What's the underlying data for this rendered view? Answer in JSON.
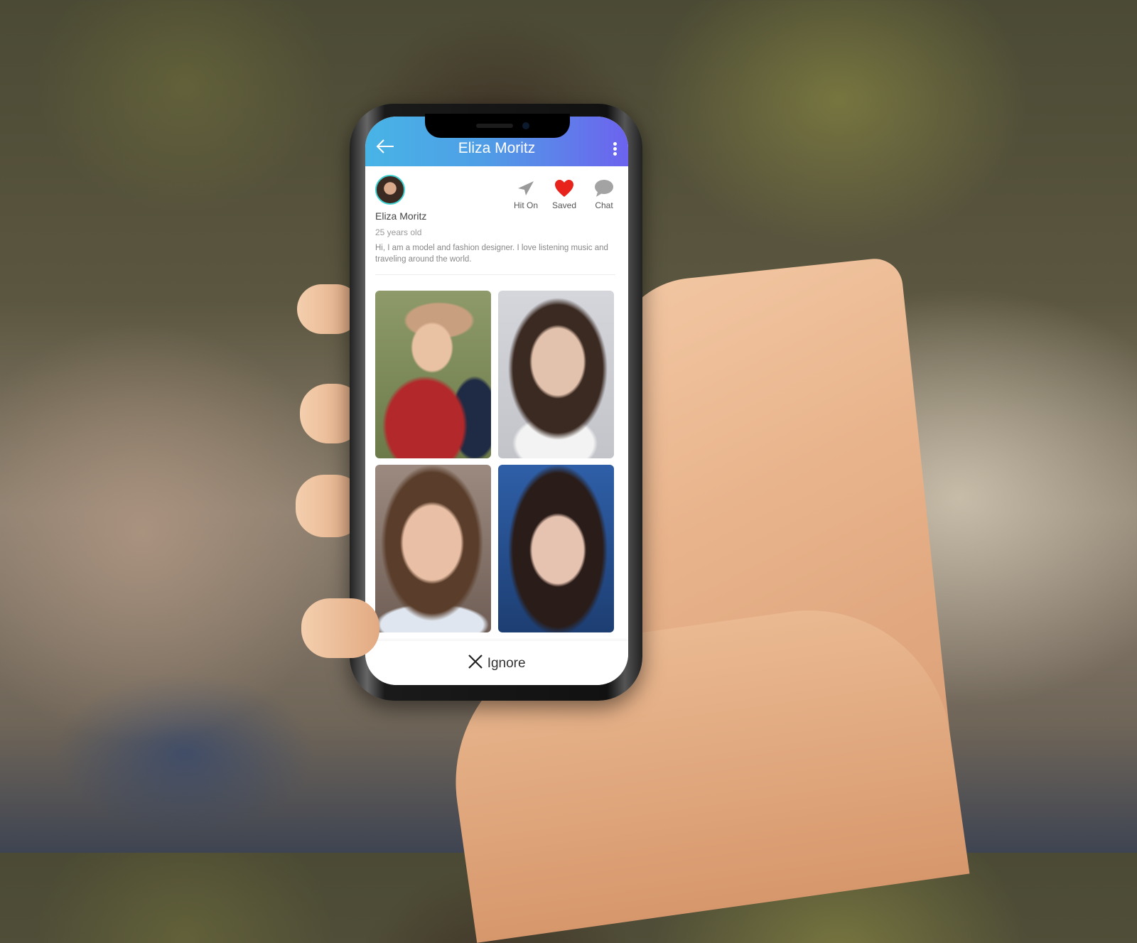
{
  "app": {
    "header": {
      "title": "Eliza Moritz",
      "back_icon": "arrow-left-icon",
      "menu_icon": "more-vertical-icon",
      "gradient_start": "#48b4e6",
      "gradient_end": "#6c63ee"
    },
    "profile": {
      "name": "Eliza Moritz",
      "age": "25 years old",
      "bio": "Hi, I am a model and fashion designer. I love listening music and traveling around the world.",
      "avatar_border_color": "#3fd0d0"
    },
    "actions": [
      {
        "label": "Hit On",
        "icon": "paper-plane-icon",
        "color": "#9a9a9a"
      },
      {
        "label": "Saved",
        "icon": "heart-icon",
        "color": "#e8231b"
      },
      {
        "label": "Chat",
        "icon": "chat-bubble-icon",
        "color": "#9a9a9a"
      }
    ],
    "photos": [
      {
        "description": "woman in hat hugging children"
      },
      {
        "description": "woman portrait in white shirt"
      },
      {
        "description": "young woman portrait"
      },
      {
        "description": "woman with bangs on blue background"
      }
    ],
    "footer": {
      "ignore_label": "Ignore",
      "ignore_icon": "close-icon"
    }
  }
}
